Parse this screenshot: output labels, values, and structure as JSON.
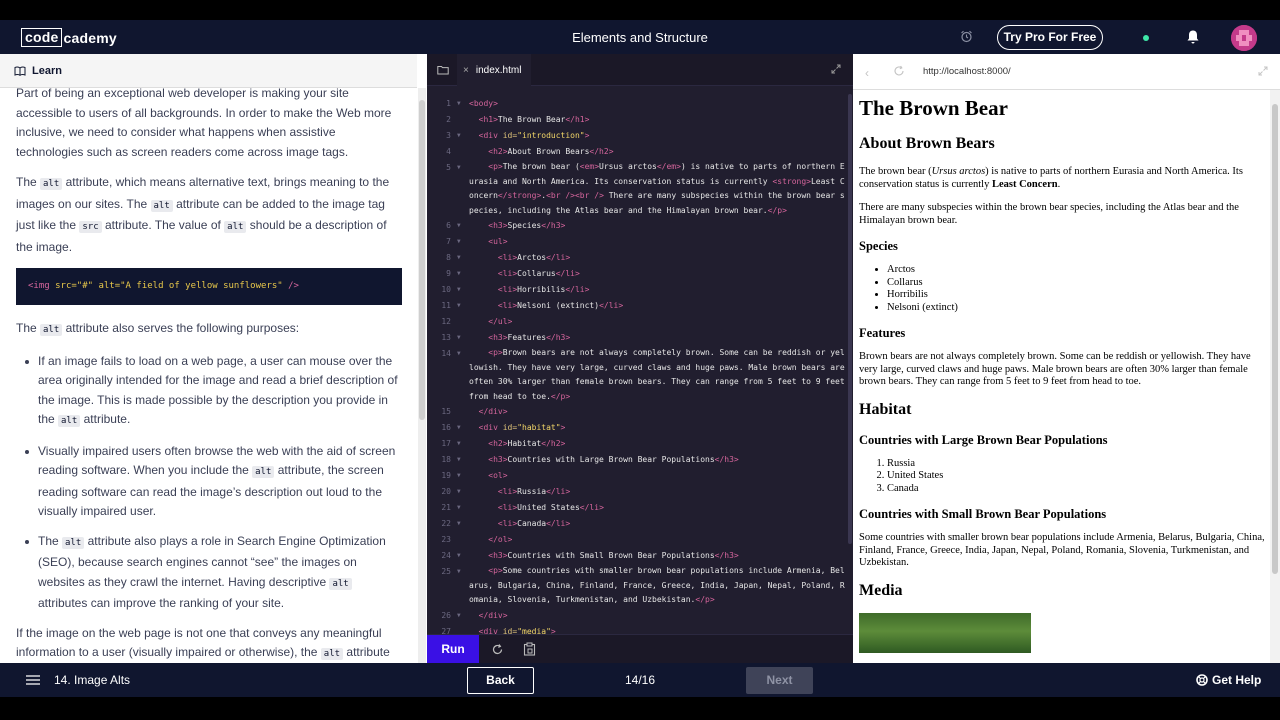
{
  "header": {
    "logo_box": "code",
    "logo_rest": "cademy",
    "lesson_title": "Elements and Structure",
    "try_pro": "Try Pro For Free"
  },
  "learn": {
    "title": "Learn",
    "p1": "Part of being an exceptional web developer is making your site accessible to users of all backgrounds. In order to make the Web more inclusive, we need to consider what happens when assistive technologies such as screen readers come across image tags.",
    "p2_a": "The ",
    "p2_code1": "alt",
    "p2_b": " attribute, which means alternative text, brings meaning to the images on our sites. The ",
    "p2_code2": "alt",
    "p2_c": " attribute can be added to the image tag just like the ",
    "p2_code3": "src",
    "p2_d": " attribute. The value of ",
    "p2_code4": "alt",
    "p2_e": " should be a description of the image.",
    "code_open": "<img",
    "code_src": " src=",
    "code_src_val": "\"#\"",
    "code_alt": " alt=",
    "code_alt_val": "\"A field of yellow sunflowers\"",
    "code_close": " />",
    "p3_a": "The ",
    "p3_code": "alt",
    "p3_b": " attribute also serves the following purposes:",
    "bullet1_a": "If an image fails to load on a web page, a user can mouse over the area originally intended for the image and read a brief description of the image. This is made possible by the description you provide in the ",
    "bullet1_code": "alt",
    "bullet1_b": " attribute.",
    "bullet2_a": "Visually impaired users often browse the web with the aid of screen reading software. When you include the ",
    "bullet2_code": "alt",
    "bullet2_b": " attribute, the screen reading software can read the image’s description out loud to the visually impaired user.",
    "bullet3_a": "The ",
    "bullet3_code1": "alt",
    "bullet3_b": " attribute also plays a role in Search Engine Optimization (SEO), because search engines cannot “see” the images on websites as they crawl the internet. Having descriptive ",
    "bullet3_code2": "alt",
    "bullet3_c": " attributes can improve the ranking of your site.",
    "p4_a": "If the image on the web page is not one that conveys any meaningful information to a user (visually impaired or otherwise), the ",
    "p4_code": "alt",
    "p4_b": " attribute should be left empty."
  },
  "editor": {
    "tab_name": "index.html",
    "run_label": "Run"
  },
  "browser": {
    "url": "http://localhost:8000/",
    "h1": "The Brown Bear",
    "h2_about": "About Brown Bears",
    "p_intro_a": "The brown bear (",
    "p_intro_em": "Ursus arctos",
    "p_intro_b": ") is native to parts of northern Eurasia and North America. Its conservation status is currently ",
    "p_intro_strong": "Least Concern",
    "p_intro_c": ".",
    "p_intro2": "There are many subspecies within the brown bear species, including the Atlas bear and the Himalayan brown bear.",
    "h3_species": "Species",
    "species": [
      "Arctos",
      "Collarus",
      "Horribilis",
      "Nelsoni (extinct)"
    ],
    "h3_features": "Features",
    "p_features": "Brown bears are not always completely brown. Some can be reddish or yellowish. They have very large, curved claws and huge paws. Male brown bears are often 30% larger than female brown bears. They can range from 5 feet to 9 feet from head to toe.",
    "h2_habitat": "Habitat",
    "h3_large": "Countries with Large Brown Bear Populations",
    "countries": [
      "Russia",
      "United States",
      "Canada"
    ],
    "h3_small": "Countries with Small Brown Bear Populations",
    "p_small": "Some countries with smaller brown bear populations include Armenia, Belarus, Bulgaria, China, Finland, France, Greece, India, Japan, Nepal, Poland, Romania, Slovenia, Turkmenistan, and Uzbekistan.",
    "h2_media": "Media"
  },
  "footer": {
    "lesson": "14. Image Alts",
    "back": "Back",
    "progress": "14/16",
    "next": "Next",
    "help": "Get Help"
  },
  "colors": {
    "header_bg": "#10162f",
    "editor_bg": "#211e2f",
    "run_button": "#3a10e5",
    "tag": "#d5659c",
    "attr": "#e0c47a",
    "string": "#f3d768"
  },
  "icons": [
    "book-icon",
    "alarm-icon",
    "bell-icon",
    "folder-icon",
    "close-icon",
    "expand-icon",
    "refresh-icon",
    "paste-icon",
    "back-arrow-icon",
    "menu-icon",
    "help-icon"
  ]
}
